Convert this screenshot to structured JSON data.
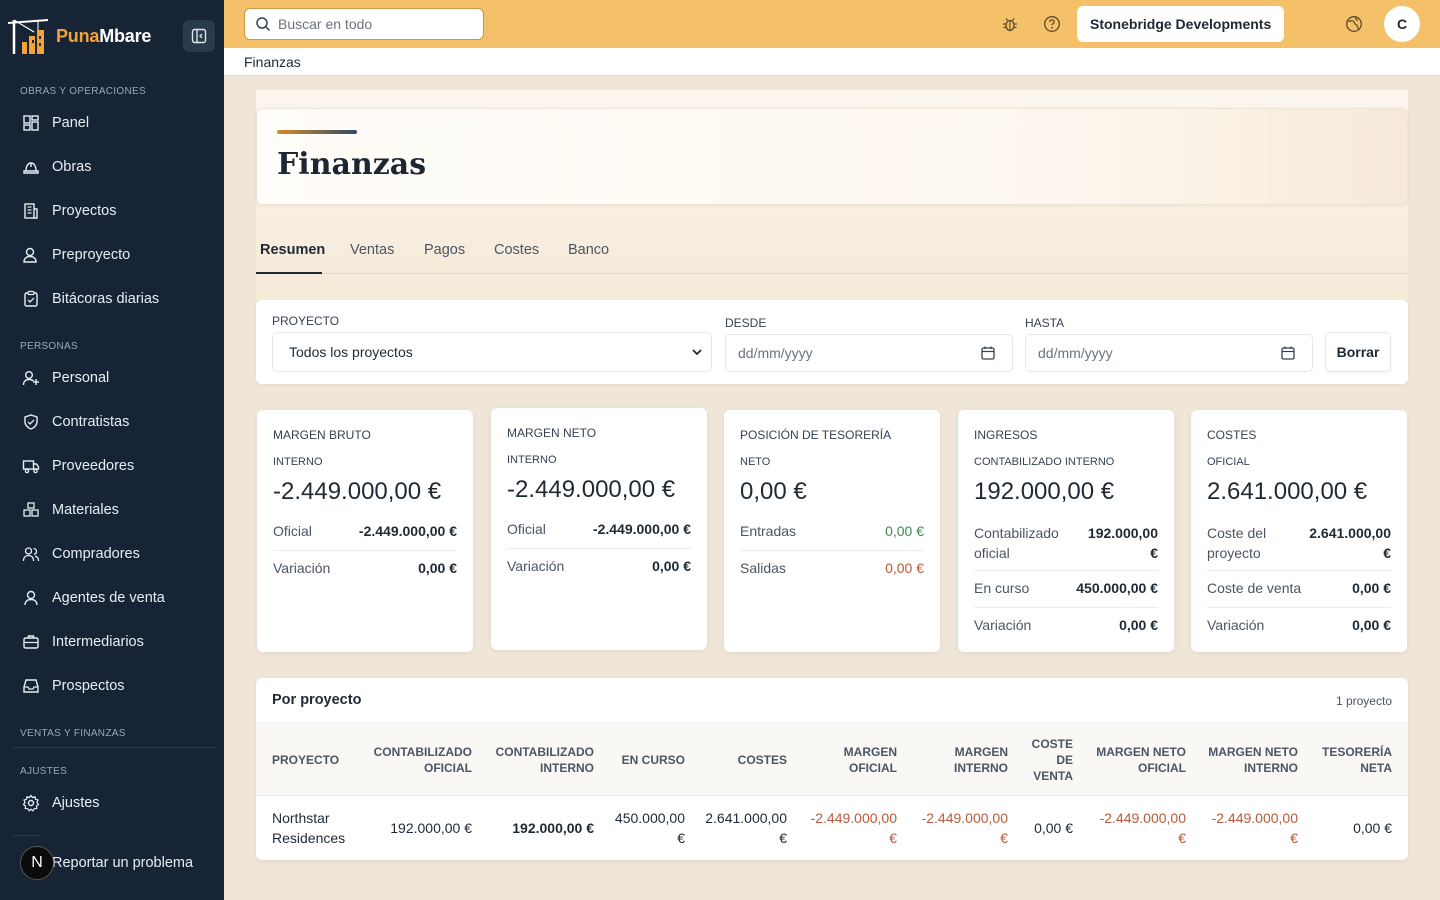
{
  "brand": {
    "name_a": "Puna",
    "name_b": "Mbare"
  },
  "sidebar": {
    "section_ops": "OBRAS Y OPERACIONES",
    "section_people": "PERSONAS",
    "section_sales": "VENTAS Y FINANZAS",
    "section_settings": "AJUSTES",
    "items": [
      {
        "label": "Panel",
        "icon": "dashboard-icon"
      },
      {
        "label": "Obras",
        "icon": "hardhat-icon"
      },
      {
        "label": "Proyectos",
        "icon": "building-icon"
      },
      {
        "label": "Preproyecto",
        "icon": "user-search-icon"
      },
      {
        "label": "Bitácoras diarias",
        "icon": "clipboard-icon"
      },
      {
        "label": "Personal",
        "icon": "user-plus-icon"
      },
      {
        "label": "Contratistas",
        "icon": "handshake-icon"
      },
      {
        "label": "Proveedores",
        "icon": "truck-icon"
      },
      {
        "label": "Materiales",
        "icon": "boxes-icon"
      },
      {
        "label": "Compradores",
        "icon": "users-icon"
      },
      {
        "label": "Agentes de venta",
        "icon": "user-icon"
      },
      {
        "label": "Intermediarios",
        "icon": "briefcase-icon"
      },
      {
        "label": "Prospectos",
        "icon": "inbox-icon"
      },
      {
        "label": "Ajustes",
        "icon": "gear-icon"
      }
    ],
    "report": "Reportar un problema",
    "report_badge": "N"
  },
  "topbar": {
    "search_placeholder": "Buscar en todo",
    "company": "Stonebridge Developments",
    "avatar": "C"
  },
  "breadcrumb": "Finanzas",
  "page_title": "Finanzas",
  "tabs": [
    "Resumen",
    "Ventas",
    "Pagos",
    "Costes",
    "Banco"
  ],
  "filters": {
    "project_label": "PROYECTO",
    "project_value": "Todos los proyectos",
    "from_label": "DESDE",
    "from_placeholder": "dd/mm/yyyy",
    "to_label": "HASTA",
    "to_placeholder": "dd/mm/yyyy",
    "clear": "Borrar"
  },
  "cards": [
    {
      "title": "MARGEN BRUTO",
      "sub": "INTERNO",
      "value": "-2.449.000,00 €",
      "rows": [
        {
          "k": "Oficial",
          "v": "-2.449.000,00 €"
        },
        {
          "k": "Variación",
          "v": "0,00 €"
        }
      ]
    },
    {
      "title": "MARGEN NETO",
      "sub": "INTERNO",
      "value": "-2.449.000,00 €",
      "rows": [
        {
          "k": "Oficial",
          "v": "-2.449.000,00 €"
        },
        {
          "k": "Variación",
          "v": "0,00 €"
        }
      ]
    },
    {
      "title": "POSICIÓN DE TESORERÍA",
      "sub": "NETO",
      "value": "0,00 €",
      "rows": [
        {
          "k": "Entradas",
          "v": "0,00 €"
        },
        {
          "k": "Salidas",
          "v": "0,00 €"
        }
      ]
    },
    {
      "title": "INGRESOS",
      "sub": "CONTABILIZADO INTERNO",
      "value": "192.000,00 €",
      "rows": [
        {
          "k1": "Contabilizado",
          "k2": "oficial",
          "v1": "192.000,00",
          "v2": "€"
        },
        {
          "k": "En curso",
          "v": "450.000,00 €"
        },
        {
          "k": "Variación",
          "v": "0,00 €"
        }
      ]
    },
    {
      "title": "COSTES",
      "sub": "OFICIAL",
      "value": "2.641.000,00 €",
      "rows": [
        {
          "k1": "Coste del",
          "k2": "proyecto",
          "v1": "2.641.000,00",
          "v2": "€"
        },
        {
          "k": "Coste de venta",
          "v": "0,00 €"
        },
        {
          "k": "Variación",
          "v": "0,00 €"
        }
      ]
    }
  ],
  "table": {
    "title": "Por proyecto",
    "count": "1 proyecto",
    "headers": [
      [
        "PROYECTO"
      ],
      [
        "CONTABILIZADO",
        "OFICIAL"
      ],
      [
        "CONTABILIZADO",
        "INTERNO"
      ],
      [
        "EN CURSO"
      ],
      [
        "COSTES"
      ],
      [
        "MARGEN",
        "OFICIAL"
      ],
      [
        "MARGEN",
        "INTERNO"
      ],
      [
        "COSTE",
        "DE",
        "VENTA"
      ],
      [
        "MARGEN NETO",
        "OFICIAL"
      ],
      [
        "MARGEN NETO",
        "INTERNO"
      ],
      [
        "TESORERÍA",
        "NETA"
      ]
    ],
    "row": {
      "project": [
        "Northstar",
        "Residences"
      ],
      "cont_oficial": "192.000,00 €",
      "cont_interno": "192.000,00 €",
      "en_curso": [
        "450.000,00",
        "€"
      ],
      "costes": [
        "2.641.000,00",
        "€"
      ],
      "margen_oficial": [
        "-2.449.000,00",
        "€"
      ],
      "margen_interno": [
        "-2.449.000,00",
        "€"
      ],
      "coste_venta": "0,00 €",
      "mn_oficial": [
        "-2.449.000,00",
        "€"
      ],
      "mn_interno": [
        "-2.449.000,00",
        "€"
      ],
      "tesoreria": "0,00 €"
    }
  },
  "colors": {
    "sidebar": "#172435",
    "topbar": "#f4c16a",
    "accent": "#f2a23a",
    "negative": "#b85a3a",
    "positive": "#3f8a4a"
  }
}
